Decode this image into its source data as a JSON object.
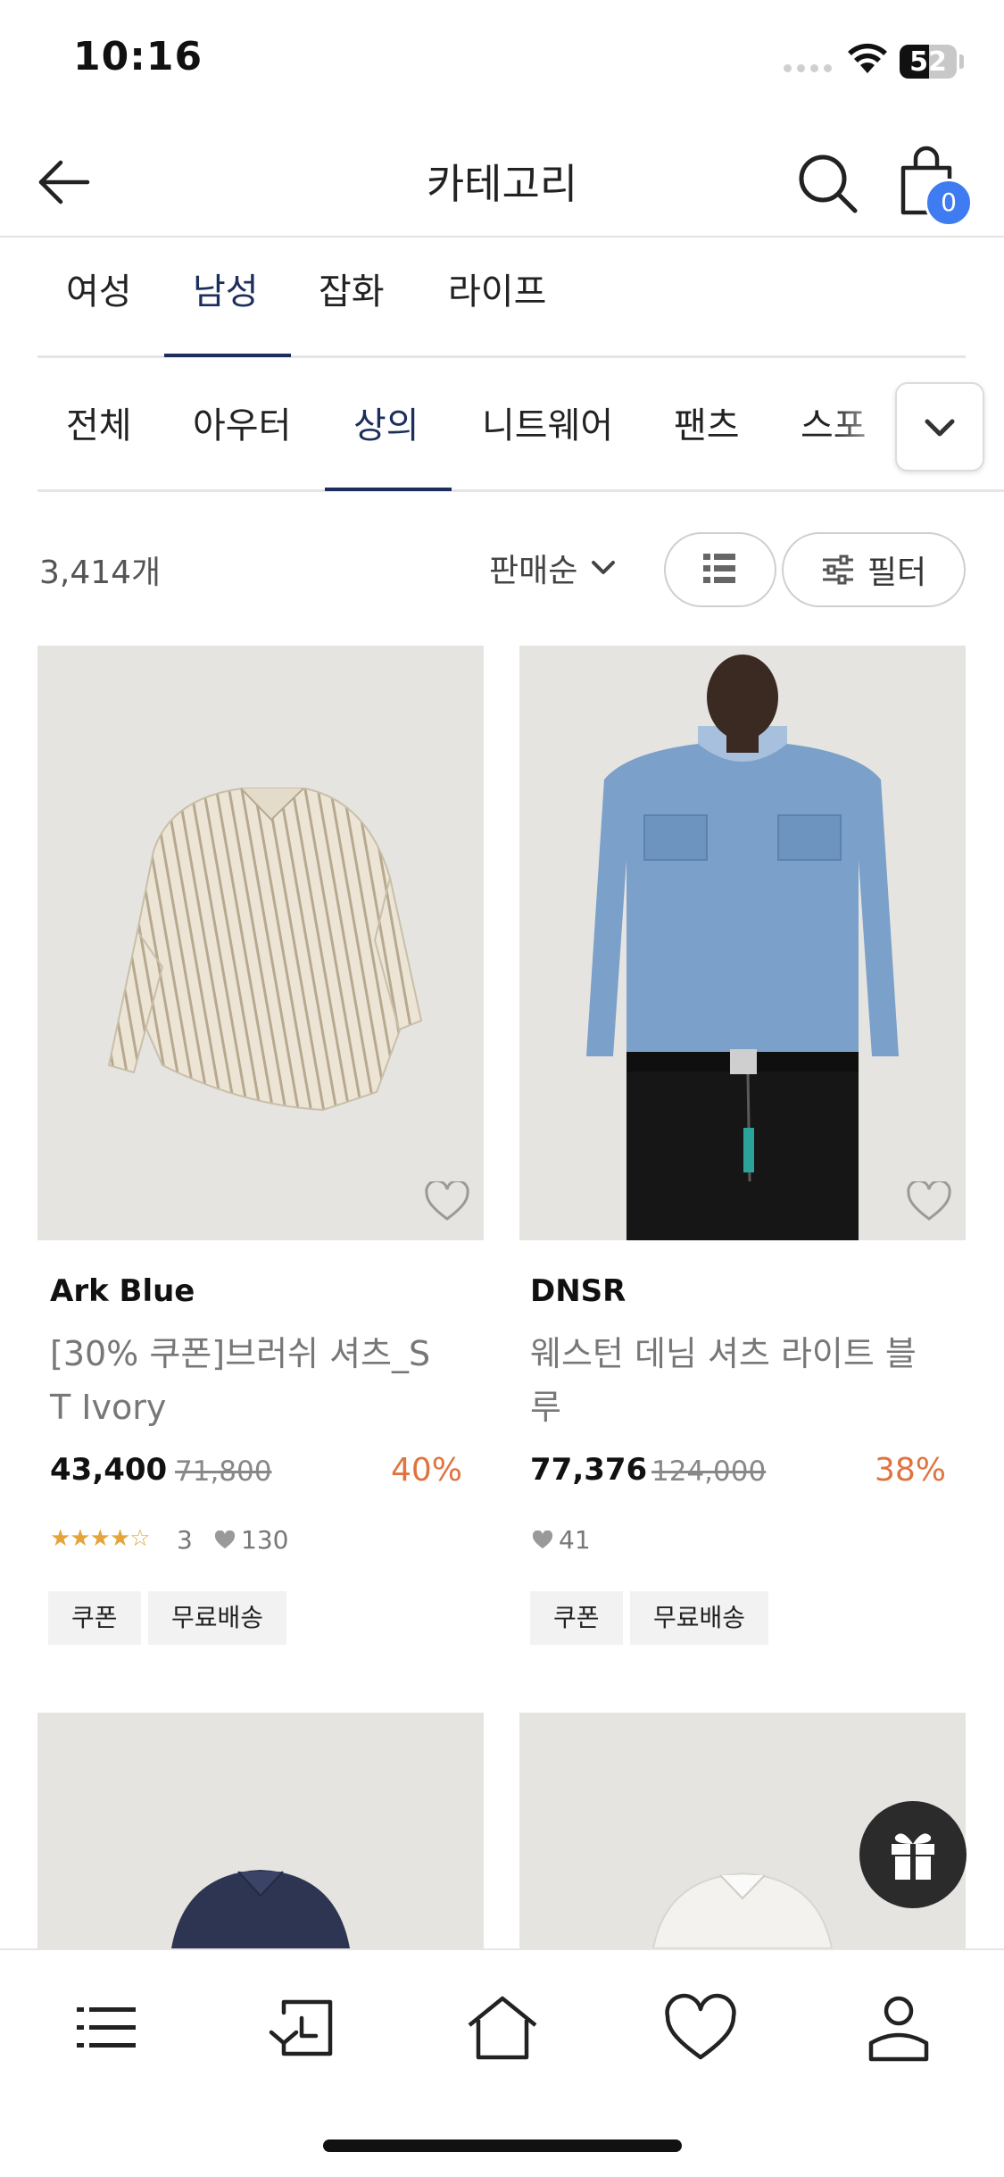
{
  "status_bar": {
    "time": "10:16",
    "battery": "52",
    "battery_level": 0.52
  },
  "header": {
    "title": "카테고리",
    "cart_count": "0"
  },
  "main_tabs": [
    {
      "label": "여성",
      "active": false
    },
    {
      "label": "남성",
      "active": true
    },
    {
      "label": "잡화",
      "active": false
    },
    {
      "label": "라이프",
      "active": false
    }
  ],
  "sub_tabs": [
    {
      "label": "전체",
      "active": false
    },
    {
      "label": "아우터",
      "active": false
    },
    {
      "label": "상의",
      "active": true
    },
    {
      "label": "니트웨어",
      "active": false
    },
    {
      "label": "팬츠",
      "active": false
    },
    {
      "label": "스포",
      "active": false
    }
  ],
  "toolbar": {
    "count": "3,414개",
    "sort_label": "판매순",
    "filter_label": "필터"
  },
  "products": [
    {
      "brand": "Ark Blue",
      "name_line1": "[30% 쿠폰]브러쉬 셔츠_S",
      "name_line2": "T Ivory",
      "price": "43,400",
      "original_price": "71,800",
      "discount": "40%",
      "rating_stars": "★★★★☆",
      "review_count": "3",
      "likes": "130",
      "tags": [
        "쿠폰",
        "무료배송"
      ]
    },
    {
      "brand": "DNSR",
      "name_line1": "웨스턴 데님 셔츠 라이트 블",
      "name_line2": "루",
      "price": "77,376",
      "original_price": "124,000",
      "discount": "38%",
      "likes": "41",
      "tags": [
        "쿠폰",
        "무료배송"
      ]
    }
  ],
  "icons": {
    "back": "arrow-left-icon",
    "search": "search-icon",
    "cart": "shopping-bag-icon",
    "nav": [
      "menu-icon",
      "recent-icon",
      "home-icon",
      "heart-icon",
      "profile-icon"
    ],
    "fab": "gift-icon"
  },
  "colors": {
    "accent_navy": "#1c2e5b",
    "discount": "#e0733e",
    "badge": "#3f7cf1",
    "star": "#e6a33a"
  }
}
